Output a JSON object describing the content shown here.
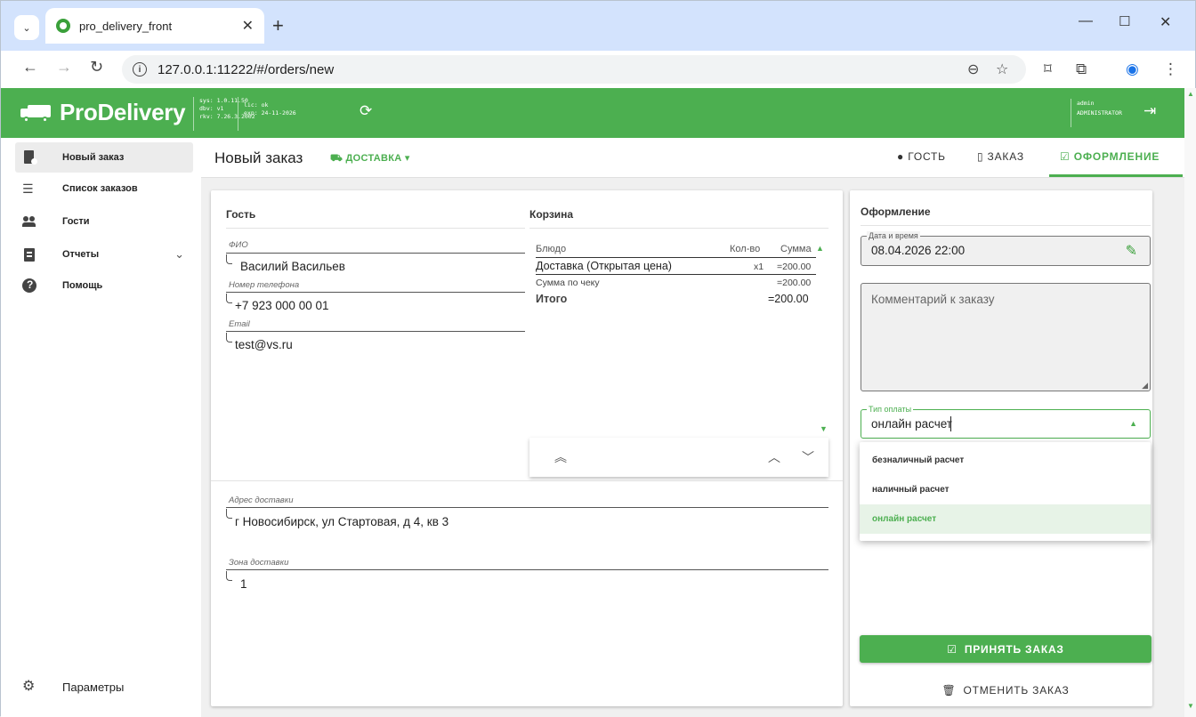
{
  "browser": {
    "tab_title": "pro_delivery_front",
    "url": "127.0.0.1:11222/#/orders/new"
  },
  "app": {
    "brand": "ProDelivery",
    "meta_sys": [
      "sys: 1.0.11.50",
      "dbv: v1",
      "rkv: 7.26.3.2002"
    ],
    "meta_lic": [
      "lic: ok",
      "exp: 24-11-2026"
    ],
    "user_name": "admin",
    "user_role": "ADMINISTRATOR",
    "accent": "#4caf50"
  },
  "sidebar": {
    "items": [
      {
        "label": "Новый заказ",
        "icon": "new-order-icon"
      },
      {
        "label": "Список заказов",
        "icon": "list-icon"
      },
      {
        "label": "Гости",
        "icon": "guests-icon"
      },
      {
        "label": "Отчеты",
        "icon": "clipboard-icon"
      },
      {
        "label": "Помощь",
        "icon": "help-icon"
      }
    ],
    "settings": "Параметры"
  },
  "header": {
    "title": "Новый заказ",
    "delivery": "ДОСТАВКА",
    "tabs": [
      "ГОСТЬ",
      "ЗАКАЗ",
      "ОФОРМЛЕНИЕ"
    ]
  },
  "guest": {
    "title": "Гость",
    "fio_label": "ФИО",
    "fio": "Василий Васильев",
    "phone_label": "Номер телефона",
    "phone": "+7 923 000 00 01",
    "email_label": "Email",
    "email": "test@vs.ru"
  },
  "cart": {
    "title": "Корзина",
    "col_dish": "Блюдо",
    "col_qty": "Кол-во",
    "col_sum": "Сумма",
    "rows": [
      {
        "dish": "Доставка (Открытая цена)",
        "qty": "x1",
        "sum": "=200.00"
      }
    ],
    "check_label": "Сумма по чеку",
    "check_sum": "=200.00",
    "total_label": "Итого",
    "total_sum": "=200.00"
  },
  "address": {
    "label": "Адрес доставки",
    "value": "г Новосибирск, ул Стартовая, д 4, кв 3",
    "zone_label": "Зона доставки",
    "zone": "1"
  },
  "checkout": {
    "title": "Оформление",
    "datetime_label": "Дата и время",
    "datetime": "08.04.2026 22:00",
    "comment_placeholder": "Комментарий к заказу",
    "payment_label": "Тип оплаты",
    "payment": "онлайн расчет",
    "payment_options": [
      "безналичный расчет",
      "наличный расчет",
      "онлайн расчет"
    ],
    "accept": "ПРИНЯТЬ ЗАКАЗ",
    "cancel": "ОТМЕНИТЬ ЗАКАЗ"
  }
}
